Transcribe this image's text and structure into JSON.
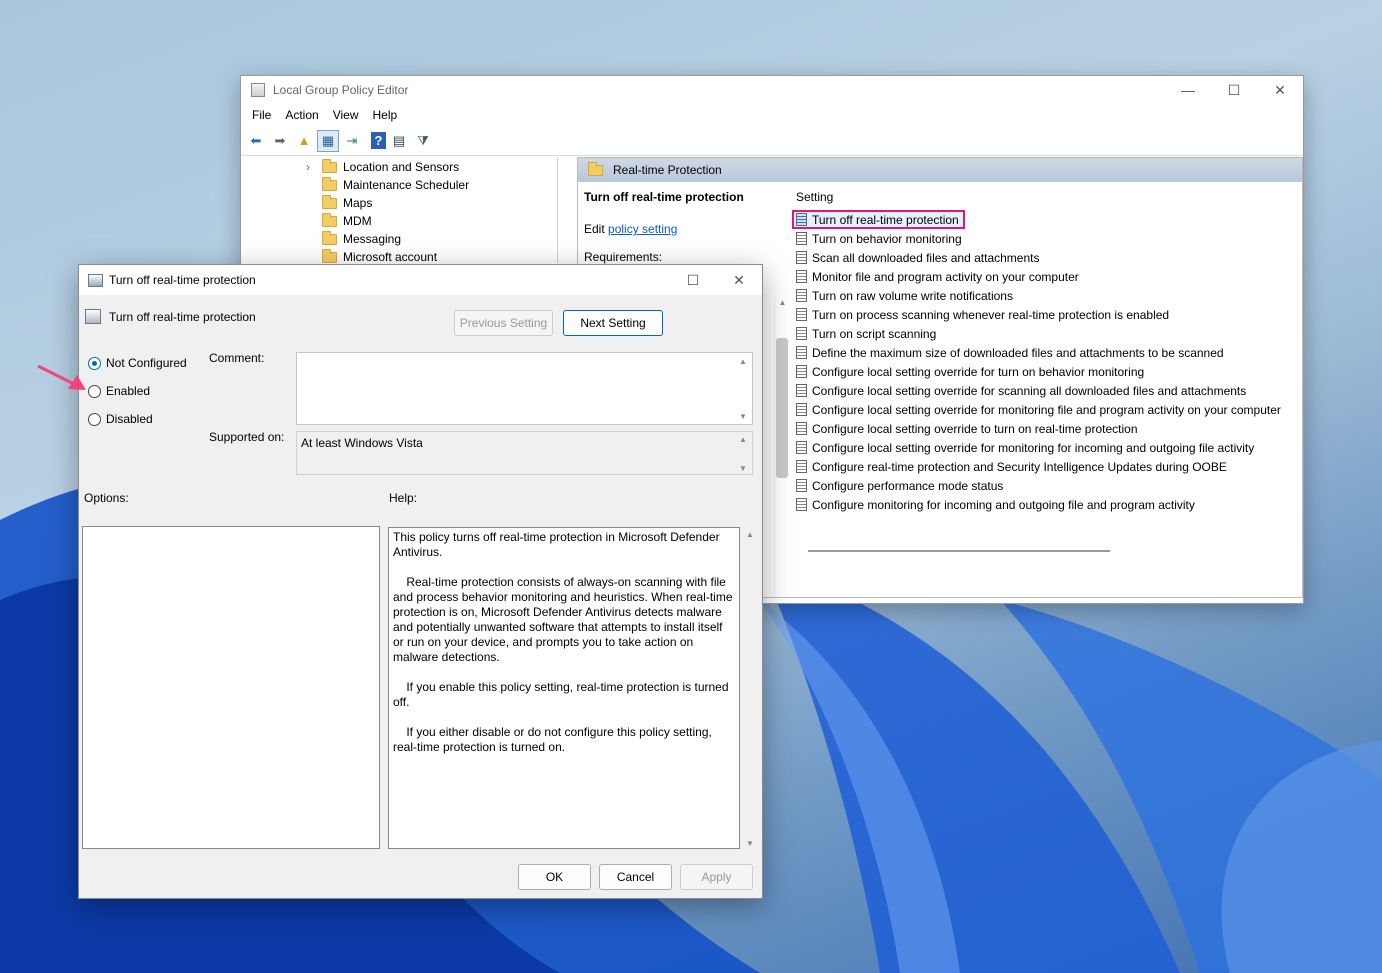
{
  "main_window": {
    "title": "Local Group Policy Editor",
    "menu": [
      "File",
      "Action",
      "View",
      "Help"
    ],
    "toolbar_icons": [
      "back-icon",
      "forward-icon",
      "up-folder-icon",
      "show-hide-tree-icon",
      "export-list-icon",
      "help-icon",
      "properties-icon",
      "filter-icon"
    ],
    "tree_items": [
      "Location and Sensors",
      "Maintenance Scheduler",
      "Maps",
      "MDM",
      "Messaging",
      "Microsoft account"
    ],
    "folder_header": "Real-time Protection",
    "extended": {
      "title": "Turn off real-time protection",
      "edit_prefix": "Edit ",
      "edit_link": "policy setting ",
      "requirements": "Requirements:"
    },
    "list_header": "Setting",
    "settings": [
      "Turn off real-time protection",
      "Turn on behavior monitoring",
      "Scan all downloaded files and attachments",
      "Monitor file and program activity on your computer",
      "Turn on raw volume write notifications",
      "Turn on process scanning whenever real-time protection is enabled",
      "Turn on script scanning",
      "Define the maximum size of downloaded files and attachments to be scanned",
      "Configure local setting override for turn on behavior monitoring",
      "Configure local setting override for scanning all downloaded files and attachments",
      "Configure local setting override for monitoring file and program activity on your computer",
      "Configure local setting override to turn on real-time protection",
      "Configure local setting override for monitoring for incoming and outgoing file activity",
      "Configure real-time protection and Security Intelligence Updates during OOBE",
      "Configure performance mode status",
      "Configure monitoring for incoming and outgoing file and program activity"
    ],
    "highlight_color": "#e6186e"
  },
  "dialog": {
    "title": "Turn off real-time protection",
    "policy_name": "Turn off real-time protection",
    "prev_label": "Previous Setting",
    "next_label": "Next Setting",
    "radios": [
      "Not Configured",
      "Enabled",
      "Disabled"
    ],
    "selected": "Not Configured",
    "comment_label": "Comment:",
    "supported_label": "Supported on:",
    "supported_value": "At least Windows Vista",
    "options_label": "Options:",
    "help_label": "Help:",
    "help_paragraphs": [
      "This policy turns off real-time protection in Microsoft Defender Antivirus.",
      "    Real-time protection consists of always-on scanning with file and process behavior monitoring and heuristics. When real-time protection is on, Microsoft Defender Antivirus detects malware and potentially unwanted software that attempts to install itself or run on your device, and prompts you to take action on malware detections.",
      "    If you enable this policy setting, real-time protection is turned off.",
      "    If you either disable or do not configure this policy setting, real-time protection is turned on."
    ],
    "ok_label": "OK",
    "cancel_label": "Cancel",
    "apply_label": "Apply"
  },
  "annotation_color": "#f0447a"
}
